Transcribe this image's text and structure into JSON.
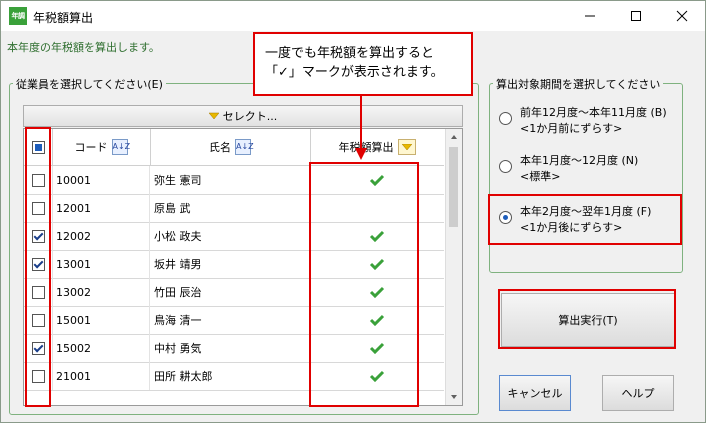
{
  "window": {
    "icon_text": "年調",
    "title": "年税額算出"
  },
  "description": "本年度の年税額を算出します。",
  "left_group": {
    "label": "従業員を選択してください(E)",
    "select_button": "セレクト..."
  },
  "table": {
    "headers": {
      "code": "コード",
      "name": "氏名",
      "tax": "年税額算出"
    },
    "sort_glyph": "A↓Z",
    "rows": [
      {
        "checked": false,
        "code": "10001",
        "name": "弥生 憲司",
        "tax_done": true
      },
      {
        "checked": false,
        "code": "12001",
        "name": "原島 武",
        "tax_done": false
      },
      {
        "checked": true,
        "code": "12002",
        "name": "小松 政夫",
        "tax_done": true
      },
      {
        "checked": true,
        "code": "13001",
        "name": "坂井 靖男",
        "tax_done": true
      },
      {
        "checked": false,
        "code": "13002",
        "name": "竹田 辰治",
        "tax_done": true
      },
      {
        "checked": false,
        "code": "15001",
        "name": "鳥海 清一",
        "tax_done": true
      },
      {
        "checked": true,
        "code": "15002",
        "name": "中村 勇気",
        "tax_done": true
      },
      {
        "checked": false,
        "code": "21001",
        "name": "田所 耕太郎",
        "tax_done": true
      }
    ]
  },
  "callout": {
    "line1": "一度でも年税額を算出すると",
    "line2": "「✓」マークが表示されます。"
  },
  "period_group": {
    "label": "算出対象期間を選択してください",
    "options": [
      {
        "line1": "前年12月度～本年11月度 (B)",
        "line2": "<1か月前にずらす>",
        "selected": false
      },
      {
        "line1": "本年1月度～12月度 (N)",
        "line2": "<標準>",
        "selected": false
      },
      {
        "line1": "本年2月度～翌年1月度 (F)",
        "line2": "<1か月後にずらす>",
        "selected": true
      }
    ]
  },
  "buttons": {
    "execute": "算出実行(T)",
    "cancel": "キャンセル",
    "help": "ヘルプ"
  },
  "colors": {
    "annotation_red": "#e00000",
    "check_green": "#3aa13a",
    "group_border": "#7fb27f"
  }
}
